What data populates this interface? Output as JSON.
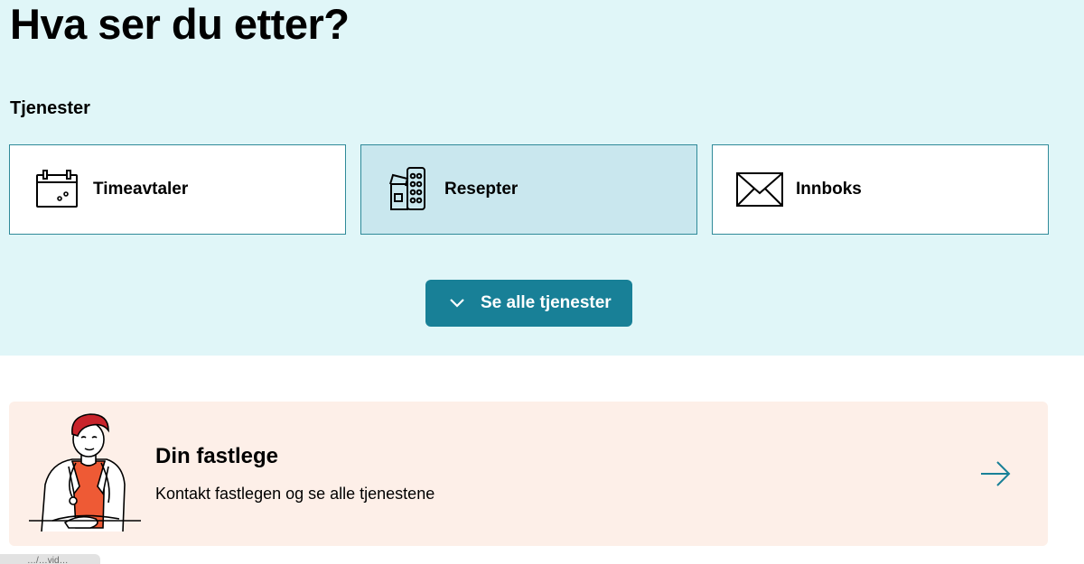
{
  "hero": {
    "heading": "Hva ser du etter?",
    "section_label": "Tjenester",
    "cards": [
      {
        "label": "Timeavtaler",
        "icon": "calendar-icon"
      },
      {
        "label": "Resepter",
        "icon": "prescription-pills-icon"
      },
      {
        "label": "Innboks",
        "icon": "envelope-icon"
      }
    ],
    "see_all_label": "Se alle tjenester"
  },
  "fastlege": {
    "title": "Din fastlege",
    "subtitle": "Kontakt fastlegen og se alle tjenestene",
    "illustration": "doctor-illustration",
    "arrow": "arrow-right-icon"
  },
  "status_bar": {
    "text": "…/…vid…"
  },
  "colors": {
    "hero_background": "#e0f6f8",
    "card_border": "#2f8a99",
    "card_active": "#c9e7ee",
    "button": "#188097",
    "fastlege_background": "#fdefe8",
    "doctor_hair": "#c8242b",
    "doctor_shirt": "#ee5a35"
  }
}
